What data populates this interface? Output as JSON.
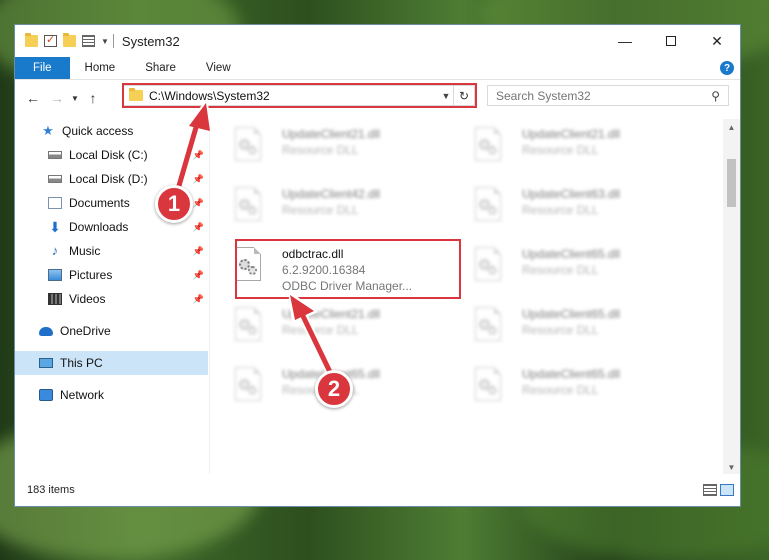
{
  "window": {
    "title": "System32"
  },
  "ribbon": {
    "tabs": [
      "File",
      "Home",
      "Share",
      "View"
    ],
    "help_label": "?"
  },
  "address": {
    "path": "C:\\Windows\\System32"
  },
  "search": {
    "placeholder": "Search System32"
  },
  "sidebar": {
    "items": [
      {
        "label": "Quick access",
        "icon": "star-icon"
      },
      {
        "label": "Local Disk (C:)",
        "icon": "drive-icon",
        "pinned": true
      },
      {
        "label": "Local Disk (D:)",
        "icon": "drive-icon",
        "pinned": true
      },
      {
        "label": "Documents",
        "icon": "documents-icon",
        "pinned": true
      },
      {
        "label": "Downloads",
        "icon": "download-icon",
        "pinned": true
      },
      {
        "label": "Music",
        "icon": "music-icon",
        "pinned": true
      },
      {
        "label": "Pictures",
        "icon": "pictures-icon",
        "pinned": true
      },
      {
        "label": "Videos",
        "icon": "videos-icon",
        "pinned": true
      },
      {
        "label": "OneDrive",
        "icon": "cloud-icon"
      },
      {
        "label": "This PC",
        "icon": "computer-icon",
        "selected": true
      },
      {
        "label": "Network",
        "icon": "network-icon"
      }
    ]
  },
  "files": [
    {
      "name": "UpdateClient21.dll",
      "type": "Resource DLL"
    },
    {
      "name": "UpdateClient21.dll",
      "type": "Resource DLL"
    },
    {
      "name": "UpdateClient42.dll",
      "type": "Resource DLL"
    },
    {
      "name": "UpdateClient63.dll",
      "type": "Resource DLL"
    },
    {
      "name": "odbctrac.dll",
      "version": "6.2.9200.16384",
      "description": "ODBC Driver Manager..."
    },
    {
      "name": "UpdateClient65.dll",
      "type": "Resource DLL"
    },
    {
      "name": "UpdateClient21.dll",
      "type": "Resource DLL"
    },
    {
      "name": "UpdateClient65.dll",
      "type": "Resource DLL"
    },
    {
      "name": "UpdateClient65.dll",
      "type": "Resource DLL"
    },
    {
      "name": "UpdateClient65.dll",
      "type": "Resource DLL"
    }
  ],
  "status": {
    "item_count": "183 items"
  },
  "annotations": {
    "step1": "1",
    "step2": "2"
  },
  "colors": {
    "accent": "#1979ca",
    "highlight": "#d9363e",
    "selection": "#cce4f7"
  }
}
